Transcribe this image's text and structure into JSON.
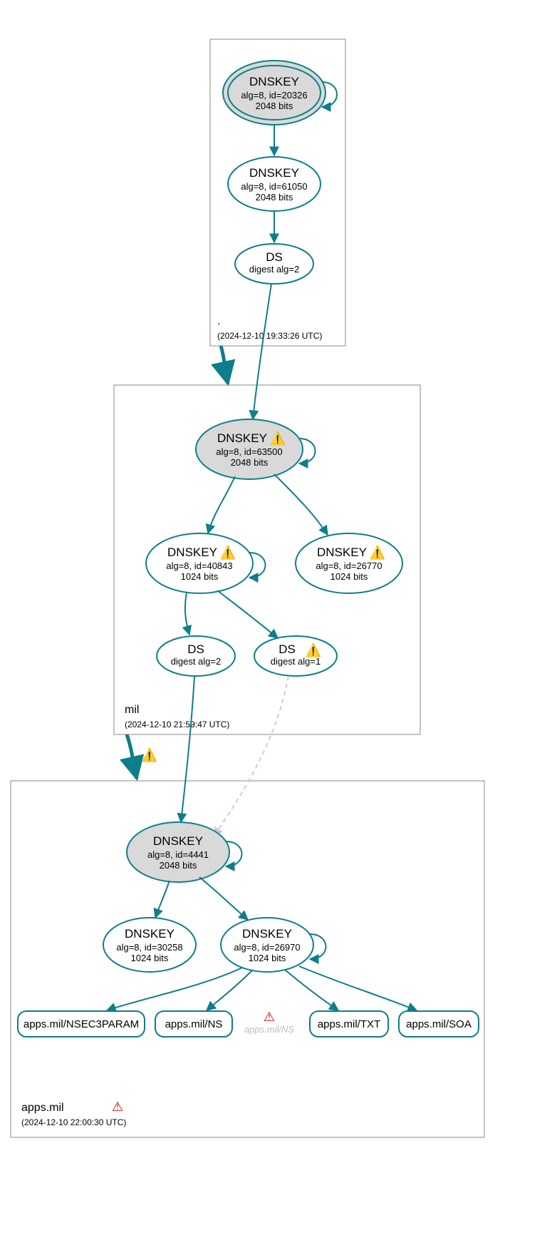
{
  "zones": {
    "root": {
      "name": ".",
      "timestamp": "(2024-12-10 19:33:26 UTC)",
      "nodes": {
        "ksk": {
          "title": "DNSKEY",
          "sub1": "alg=8, id=20326",
          "sub2": "2048 bits"
        },
        "zsk": {
          "title": "DNSKEY",
          "sub1": "alg=8, id=61050",
          "sub2": "2048 bits"
        },
        "ds": {
          "title": "DS",
          "sub1": "digest alg=2"
        }
      }
    },
    "mil": {
      "name": "mil",
      "timestamp": "(2024-12-10 21:59:47 UTC)",
      "nodes": {
        "ksk": {
          "title": "DNSKEY",
          "sub1": "alg=8, id=63500",
          "sub2": "2048 bits"
        },
        "zsk1": {
          "title": "DNSKEY",
          "sub1": "alg=8, id=40843",
          "sub2": "1024 bits"
        },
        "zsk2": {
          "title": "DNSKEY",
          "sub1": "alg=8, id=26770",
          "sub2": "1024 bits"
        },
        "ds2": {
          "title": "DS",
          "sub1": "digest alg=2"
        },
        "ds1": {
          "title": "DS",
          "sub1": "digest alg=1"
        }
      }
    },
    "apps": {
      "name": "apps.mil",
      "timestamp": "(2024-12-10 22:00:30 UTC)",
      "nodes": {
        "ksk": {
          "title": "DNSKEY",
          "sub1": "alg=8, id=4441",
          "sub2": "2048 bits"
        },
        "zsk1": {
          "title": "DNSKEY",
          "sub1": "alg=8, id=30258",
          "sub2": "1024 bits"
        },
        "zsk2": {
          "title": "DNSKEY",
          "sub1": "alg=8, id=26970",
          "sub2": "1024 bits"
        }
      },
      "rrsets": {
        "nsec3p": "apps.mil/NSEC3PARAM",
        "ns": "apps.mil/NS",
        "ns_bad": "apps.mil/NS",
        "txt": "apps.mil/TXT",
        "soa": "apps.mil/SOA"
      }
    }
  }
}
